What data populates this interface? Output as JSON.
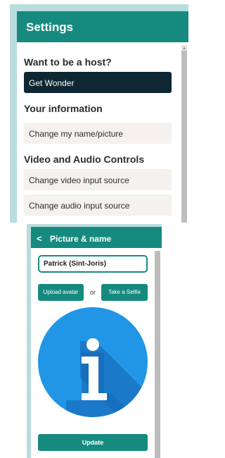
{
  "settings": {
    "title": "Settings",
    "host_heading": "Want to be a host?",
    "get_wonder": "Get Wonder",
    "info_heading": "Your information",
    "change_name": "Change my name/picture",
    "av_heading": "Video and Audio Controls",
    "change_video": "Change video input source",
    "change_audio": "Change audio input source"
  },
  "picture": {
    "back_glyph": "<",
    "title": "Picture & name",
    "name_value": "Patrick (Sint-Joris)",
    "upload_label": "Upload avatar",
    "or_label": "or",
    "selfie_label": "Take a Selfie",
    "avatar_glyph": "i",
    "update_label": "Update"
  },
  "colors": {
    "accent": "#178a80",
    "dark_button": "#0e2733",
    "row_bg": "#f4f1ef",
    "avatar_blue": "#2196e6"
  },
  "icons": {
    "back": "chevron-left-icon",
    "avatar": "info-icon"
  }
}
